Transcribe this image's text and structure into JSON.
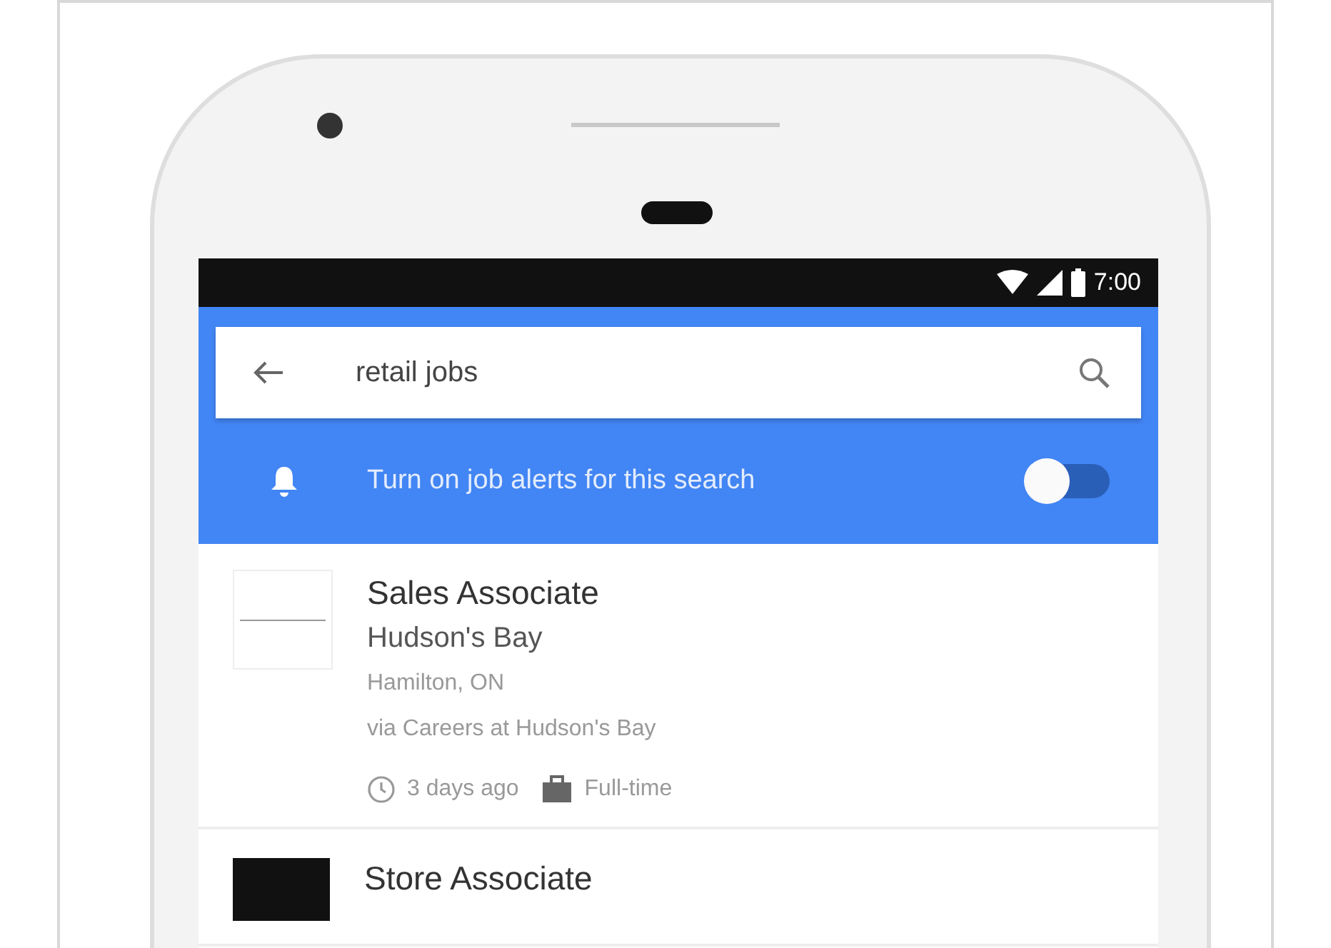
{
  "status_bar": {
    "time": "7:00"
  },
  "search": {
    "value": "retail jobs"
  },
  "alert": {
    "label": "Turn on job alerts for this search",
    "on": false
  },
  "jobs": [
    {
      "title": "Sales Associate",
      "company": "Hudson's Bay",
      "location": "Hamilton, ON",
      "source": "via Careers at Hudson's Bay",
      "posted": "3 days ago",
      "type": "Full-time",
      "kind": "light-logo"
    },
    {
      "title": "Store Associate",
      "kind": "dark-logo"
    }
  ]
}
